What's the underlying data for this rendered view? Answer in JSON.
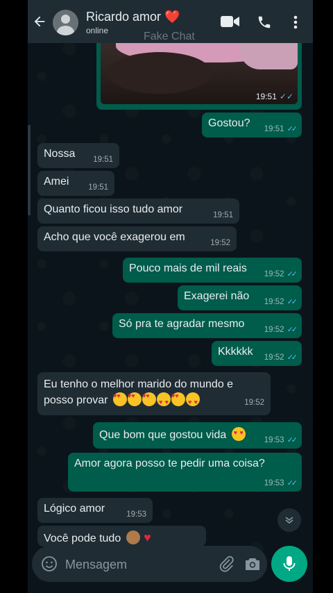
{
  "header": {
    "contact_name": "Ricardo amor ❤️",
    "status": "online",
    "watermark": "Fake Chat"
  },
  "image_message": {
    "time": "19:51"
  },
  "messages": [
    {
      "dir": "out",
      "text": "Gostou?",
      "time": "19:51"
    },
    {
      "dir": "in",
      "text": "Nossa",
      "time": "19:51"
    },
    {
      "dir": "in",
      "text": "Amei",
      "time": "19:51"
    },
    {
      "dir": "in",
      "text": "Quanto ficou isso tudo amor",
      "time": "19:51"
    },
    {
      "dir": "in",
      "text": "Acho que você exagerou em",
      "time": "19:52"
    },
    {
      "dir": "out",
      "text": "Pouco mais de mil reais",
      "time": "19:52"
    },
    {
      "dir": "out",
      "text": "Exagerei não",
      "time": "19:52"
    },
    {
      "dir": "out",
      "text": "Só pra te agradar mesmo",
      "time": "19:52"
    },
    {
      "dir": "out",
      "text": "Kkkkkk",
      "time": "19:52"
    },
    {
      "dir": "in",
      "text": "Eu tenho o melhor marido do mundo e",
      "text2": "posso provar",
      "time": "19:52"
    },
    {
      "dir": "out",
      "text": "Que bom que gostou vida",
      "time": "19:53"
    },
    {
      "dir": "out",
      "text": "Amor agora posso te pedir uma coisa?",
      "time": "19:53"
    },
    {
      "dir": "in",
      "text": "Lógico amor",
      "time": "19:53"
    },
    {
      "dir": "in",
      "text": "Você pode tudo"
    }
  ],
  "input": {
    "placeholder": "Mensagem"
  },
  "colors": {
    "incoming": "#1f2c34",
    "outgoing": "#005c4b",
    "accent": "#00a884",
    "read_ticks": "#53bdeb"
  },
  "icons": [
    "back-arrow-icon",
    "avatar-icon",
    "video-call-icon",
    "phone-icon",
    "more-vert-icon",
    "emoji-icon",
    "attach-icon",
    "camera-icon",
    "mic-icon",
    "chevron-down-icon"
  ]
}
